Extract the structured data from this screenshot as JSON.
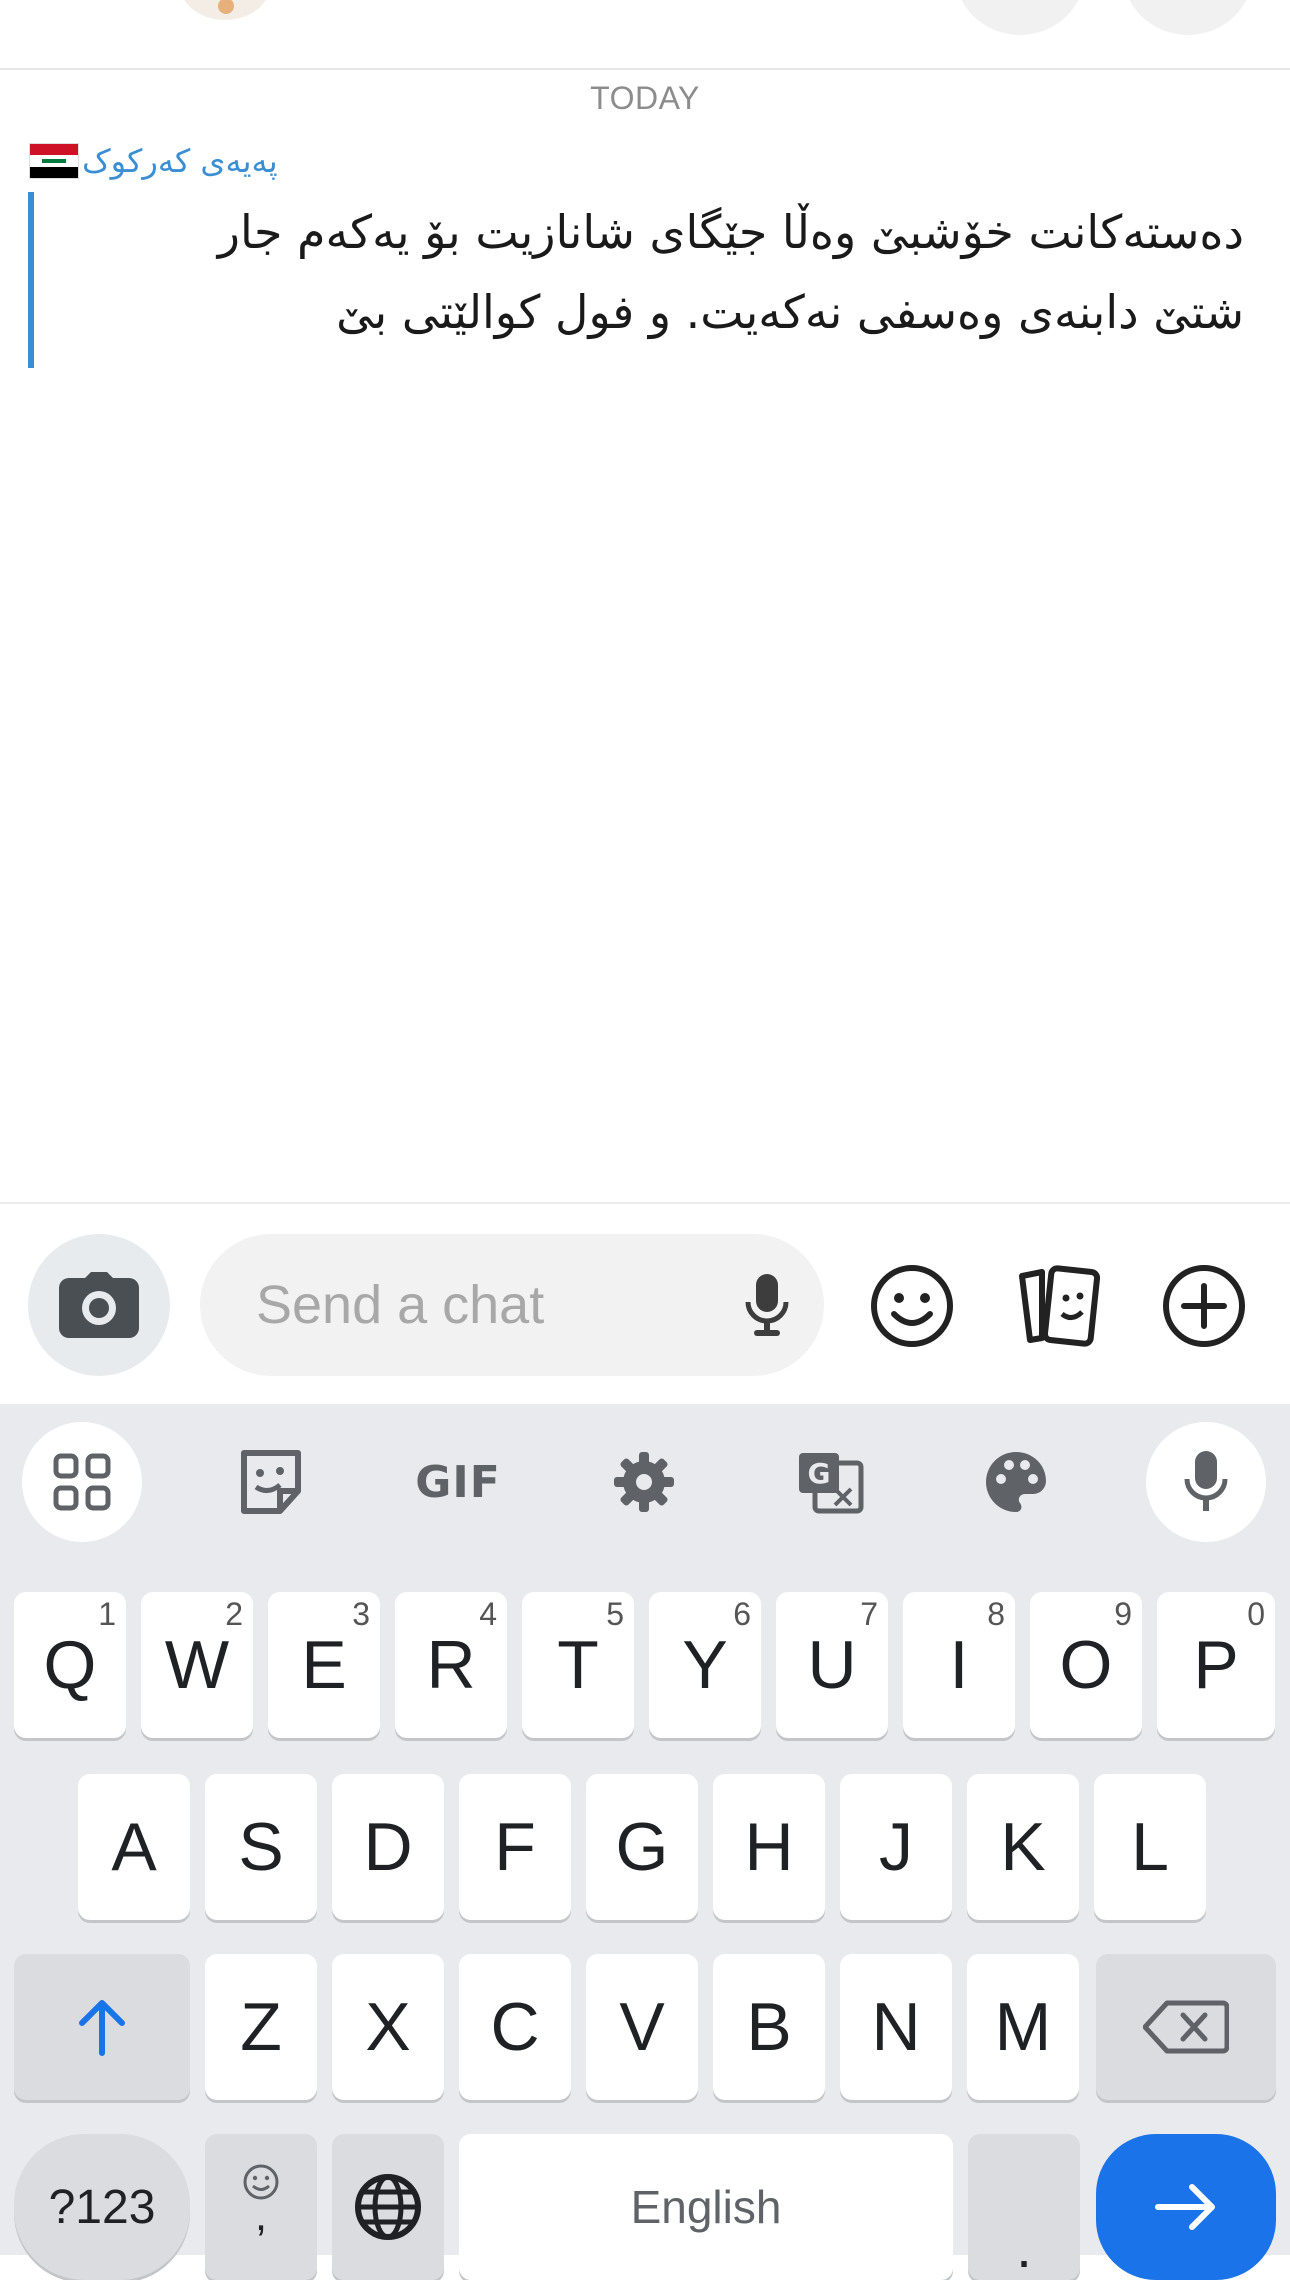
{
  "header": {},
  "chat": {
    "date_separator": "TODAY",
    "message": {
      "sender": "پەیەی کەرکوک",
      "lines": [
        "دەستەکانت خۆشبێ وەڵا جێگای شانازیت بۆ یەکەم جار",
        "شتێ دابنەی وەسفی نەکەیت. و فول کوالێتی بێ"
      ]
    }
  },
  "input_bar": {
    "placeholder": "Send a chat",
    "icons": [
      "camera-icon",
      "microphone-icon",
      "emoji-icon",
      "stickers-icon",
      "plus-icon"
    ]
  },
  "keyboard": {
    "toolbar": {
      "gif_label": "GIF",
      "icons": [
        "apps-grid-icon",
        "sticker-icon",
        "gif",
        "settings-icon",
        "translate-icon",
        "palette-icon",
        "microphone-icon"
      ]
    },
    "row1": [
      {
        "label": "Q",
        "hint": "1"
      },
      {
        "label": "W",
        "hint": "2"
      },
      {
        "label": "E",
        "hint": "3"
      },
      {
        "label": "R",
        "hint": "4"
      },
      {
        "label": "T",
        "hint": "5"
      },
      {
        "label": "Y",
        "hint": "6"
      },
      {
        "label": "U",
        "hint": "7"
      },
      {
        "label": "I",
        "hint": "8"
      },
      {
        "label": "O",
        "hint": "9"
      },
      {
        "label": "P",
        "hint": "0"
      }
    ],
    "row2": [
      "A",
      "S",
      "D",
      "F",
      "G",
      "H",
      "J",
      "K",
      "L"
    ],
    "row3": [
      "Z",
      "X",
      "C",
      "V",
      "B",
      "N",
      "M"
    ],
    "symbols_label": "?123",
    "emoji_key_sub": ",",
    "space_label": "English",
    "period_label": ".",
    "colors": {
      "accent": "#1a73e8",
      "sender": "#3a8ed3"
    }
  }
}
